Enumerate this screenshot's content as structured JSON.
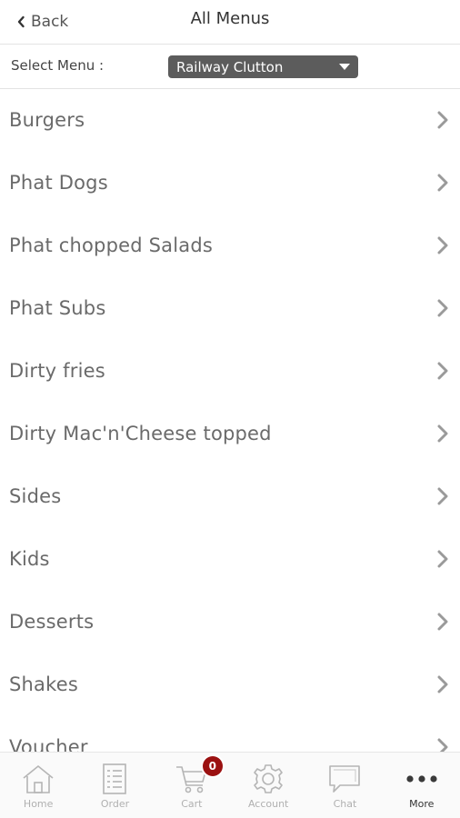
{
  "header": {
    "back_label": "Back",
    "title": "All Menus"
  },
  "select_menu": {
    "label": "Select Menu :",
    "selected_value": "Railway Clutton"
  },
  "menu_items": [
    {
      "label": "Burgers"
    },
    {
      "label": "Phat Dogs"
    },
    {
      "label": "Phat chopped Salads"
    },
    {
      "label": "Phat Subs"
    },
    {
      "label": "Dirty fries"
    },
    {
      "label": "Dirty Mac'n'Cheese topped"
    },
    {
      "label": "Sides"
    },
    {
      "label": "Kids"
    },
    {
      "label": "Desserts"
    },
    {
      "label": "Shakes"
    },
    {
      "label": "Voucher"
    }
  ],
  "tabbar": {
    "tabs": [
      {
        "label": "Home",
        "icon": "home-icon"
      },
      {
        "label": "Order",
        "icon": "order-list-icon"
      },
      {
        "label": "Cart",
        "icon": "cart-icon"
      },
      {
        "label": "Account",
        "icon": "gear-icon"
      },
      {
        "label": "Chat",
        "icon": "chat-bubble-icon"
      },
      {
        "label": "More",
        "icon": "more-dots-icon"
      }
    ],
    "cart_count": "0",
    "active_tab": "More"
  },
  "colors": {
    "badge": "#9b1111",
    "select_background": "#5c5c5c",
    "menu_text": "#6a6a6a"
  }
}
